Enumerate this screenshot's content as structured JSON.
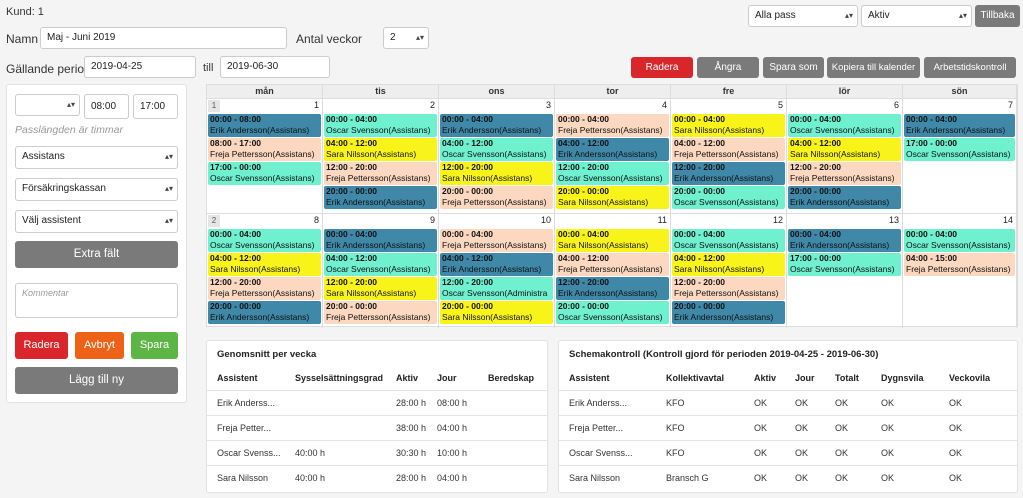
{
  "customer_label": "Kund: 1",
  "name": {
    "label": "Namn",
    "value": "Maj - Juni 2019"
  },
  "weeks": {
    "label": "Antal veckor",
    "value": "2"
  },
  "period": {
    "label": "Gällande period",
    "from": "2019-04-25",
    "till_label": "till",
    "to": "2019-06-30"
  },
  "topright": {
    "filter_shift": "Alla pass",
    "filter_status": "Aktiv",
    "back_label": "Tillbaka"
  },
  "toolbar": {
    "delete": "Radera",
    "undo": "Ångra",
    "save_as": "Spara som",
    "copy": "Kopiera till kalender",
    "work_control": "Arbetstidskontroll"
  },
  "form": {
    "day_select": "",
    "start": "08:00",
    "end": "17:00",
    "hint": "Passlängden är timmar",
    "role": "Assistans",
    "insurer": "Försäkringskassan",
    "assistant": "Välj assistent",
    "extra_label": "Extra fält",
    "comment_placeholder": "Kommentar",
    "delete": "Radera",
    "cancel": "Avbryt",
    "save": "Spara",
    "add_new": "Lägg till ny"
  },
  "calendar": {
    "days": [
      "mån",
      "tis",
      "ons",
      "tor",
      "fre",
      "lör",
      "sön"
    ],
    "weeks": [
      {
        "week": "1",
        "cells": [
          {
            "date": "1",
            "shifts": [
              {
                "time": "00:00 - 08:00",
                "name": "Erik Andersson(Assistans)",
                "color": "blue"
              },
              {
                "time": "08:00 - 17:00",
                "name": "Freja Pettersson(Assistans)",
                "color": "peach"
              },
              {
                "time": "17:00 - 00:00",
                "name": "Oscar Svensson(Assistans)",
                "color": "teal"
              }
            ]
          },
          {
            "date": "2",
            "shifts": [
              {
                "time": "00:00 - 04:00",
                "name": "Oscar Svensson(Assistans)",
                "color": "teal"
              },
              {
                "time": "04:00 - 12:00",
                "name": "Sara Nilsson(Assistans)",
                "color": "yellow"
              },
              {
                "time": "12:00 - 20:00",
                "name": "Freja Pettersson(Assistans)",
                "color": "peach"
              },
              {
                "time": "20:00 - 00:00",
                "name": "Erik Andersson(Assistans)",
                "color": "blue"
              }
            ]
          },
          {
            "date": "3",
            "shifts": [
              {
                "time": "00:00 - 04:00",
                "name": "Erik Andersson(Assistans)",
                "color": "blue"
              },
              {
                "time": "04:00 - 12:00",
                "name": "Oscar Svensson(Assistans)",
                "color": "teal"
              },
              {
                "time": "12:00 - 20:00",
                "name": "Sara Nilsson(Assistans)",
                "color": "yellow"
              },
              {
                "time": "20:00 - 00:00",
                "name": "Freja Pettersson(Assistans)",
                "color": "peach"
              }
            ]
          },
          {
            "date": "4",
            "shifts": [
              {
                "time": "00:00 - 04:00",
                "name": "Freja Pettersson(Assistans)",
                "color": "peach"
              },
              {
                "time": "04:00 - 12:00",
                "name": "Erik Andersson(Assistans)",
                "color": "blue"
              },
              {
                "time": "12:00 - 20:00",
                "name": "Oscar Svensson(Assistans)",
                "color": "teal"
              },
              {
                "time": "20:00 - 00:00",
                "name": "Sara Nilsson(Assistans)",
                "color": "yellow"
              }
            ]
          },
          {
            "date": "5",
            "shifts": [
              {
                "time": "00:00 - 04:00",
                "name": "Sara Nilsson(Assistans)",
                "color": "yellow"
              },
              {
                "time": "04:00 - 12:00",
                "name": "Freja Pettersson(Assistans)",
                "color": "peach"
              },
              {
                "time": "12:00 - 20:00",
                "name": "Erik Andersson(Assistans)",
                "color": "blue"
              },
              {
                "time": "20:00 - 00:00",
                "name": "Oscar Svensson(Assistans)",
                "color": "teal"
              }
            ]
          },
          {
            "date": "6",
            "shifts": [
              {
                "time": "00:00 - 04:00",
                "name": "Oscar Svensson(Assistans)",
                "color": "teal"
              },
              {
                "time": "04:00 - 12:00",
                "name": "Sara Nilsson(Assistans)",
                "color": "yellow"
              },
              {
                "time": "12:00 - 20:00",
                "name": "Freja Pettersson(Assistans)",
                "color": "peach"
              },
              {
                "time": "20:00 - 00:00",
                "name": "Erik Andersson(Assistans)",
                "color": "blue"
              }
            ]
          },
          {
            "date": "7",
            "shifts": [
              {
                "time": "00:00 - 04:00",
                "name": "Erik Andersson(Assistans)",
                "color": "blue"
              },
              {
                "time": "17:00 - 00:00",
                "name": "Oscar Svensson(Assistans)",
                "color": "teal"
              }
            ]
          }
        ]
      },
      {
        "week": "2",
        "cells": [
          {
            "date": "8",
            "shifts": [
              {
                "time": "00:00 - 04:00",
                "name": "Oscar Svensson(Assistans)",
                "color": "teal"
              },
              {
                "time": "04:00 - 12:00",
                "name": "Sara Nilsson(Assistans)",
                "color": "yellow"
              },
              {
                "time": "12:00 - 20:00",
                "name": "Freja Pettersson(Assistans)",
                "color": "peach"
              },
              {
                "time": "20:00 - 00:00",
                "name": "Erik Andersson(Assistans)",
                "color": "blue"
              }
            ]
          },
          {
            "date": "9",
            "shifts": [
              {
                "time": "00:00 - 04:00",
                "name": "Erik Andersson(Assistans)",
                "color": "blue"
              },
              {
                "time": "04:00 - 12:00",
                "name": "Oscar Svensson(Assistans)",
                "color": "teal"
              },
              {
                "time": "12:00 - 20:00",
                "name": "Sara Nilsson(Assistans)",
                "color": "yellow"
              },
              {
                "time": "20:00 - 00:00",
                "name": "Freja Pettersson(Assistans)",
                "color": "peach"
              }
            ]
          },
          {
            "date": "10",
            "shifts": [
              {
                "time": "00:00 - 04:00",
                "name": "Freja Pettersson(Assistans)",
                "color": "peach"
              },
              {
                "time": "04:00 - 12:00",
                "name": "Erik Andersson(Assistans)",
                "color": "blue"
              },
              {
                "time": "12:00 - 20:00",
                "name": "Oscar Svensson(Administra",
                "color": "teal"
              },
              {
                "time": "20:00 - 00:00",
                "name": "Sara Nilsson(Assistans)",
                "color": "yellow"
              }
            ]
          },
          {
            "date": "11",
            "shifts": [
              {
                "time": "00:00 - 04:00",
                "name": "Sara Nilsson(Assistans)",
                "color": "yellow"
              },
              {
                "time": "04:00 - 12:00",
                "name": "Freja Pettersson(Assistans)",
                "color": "peach"
              },
              {
                "time": "12:00 - 20:00",
                "name": "Erik Andersson(Assistans)",
                "color": "blue"
              },
              {
                "time": "20:00 - 00:00",
                "name": "Oscar Svensson(Assistans)",
                "color": "teal"
              }
            ]
          },
          {
            "date": "12",
            "shifts": [
              {
                "time": "00:00 - 04:00",
                "name": "Oscar Svensson(Assistans)",
                "color": "teal"
              },
              {
                "time": "04:00 - 12:00",
                "name": "Sara Nilsson(Assistans)",
                "color": "yellow"
              },
              {
                "time": "12:00 - 20:00",
                "name": "Freja Pettersson(Assistans)",
                "color": "peach"
              },
              {
                "time": "20:00 - 00:00",
                "name": "Erik Andersson(Assistans)",
                "color": "blue"
              }
            ]
          },
          {
            "date": "13",
            "shifts": [
              {
                "time": "00:00 - 04:00",
                "name": "Erik Andersson(Assistans)",
                "color": "blue"
              },
              {
                "time": "17:00 - 00:00",
                "name": "Oscar Svensson(Assistans)",
                "color": "teal"
              }
            ]
          },
          {
            "date": "14",
            "shifts": [
              {
                "time": "00:00 - 04:00",
                "name": "Oscar Svensson(Assistans)",
                "color": "teal"
              },
              {
                "time": "04:00 - 15:00",
                "name": "Freja Pettersson(Assistans)",
                "color": "peach"
              }
            ]
          }
        ]
      }
    ]
  },
  "weekly_avg": {
    "title": "Genomsnitt per vecka",
    "headers": [
      "Assistent",
      "Sysselsättningsgrad",
      "Aktiv",
      "Jour",
      "Beredskap"
    ],
    "rows": [
      [
        "Erik Anderss...",
        "",
        "28:00 h",
        "08:00 h",
        ""
      ],
      [
        "Freja Petter...",
        "",
        "38:00 h",
        "04:00 h",
        ""
      ],
      [
        "Oscar Svenss...",
        "40:00 h",
        "30:30 h",
        "10:00 h",
        ""
      ],
      [
        "Sara Nilsson",
        "40:00 h",
        "28:00 h",
        "04:00 h",
        ""
      ]
    ]
  },
  "schedule_check": {
    "title": "Schemakontroll (Kontroll gjord för perioden 2019-04-25 - 2019-06-30)",
    "headers": [
      "Assistent",
      "Kollektivavtal",
      "Aktiv",
      "Jour",
      "Totalt",
      "Dygnsvila",
      "Veckovila"
    ],
    "rows": [
      [
        "Erik Anderss...",
        "KFO",
        "OK",
        "OK",
        "OK",
        "OK",
        "OK"
      ],
      [
        "Freja Petter...",
        "KFO",
        "OK",
        "OK",
        "OK",
        "OK",
        "OK"
      ],
      [
        "Oscar Svenss...",
        "KFO",
        "OK",
        "OK",
        "OK",
        "OK",
        "OK"
      ],
      [
        "Sara Nilsson",
        "Bransch G",
        "OK",
        "OK",
        "OK",
        "OK",
        "OK"
      ]
    ]
  },
  "colors": {
    "blue": "#3f88a8",
    "teal": "#6ff0cf",
    "peach": "#fbd8bf",
    "yellow": "#f8f41a"
  }
}
